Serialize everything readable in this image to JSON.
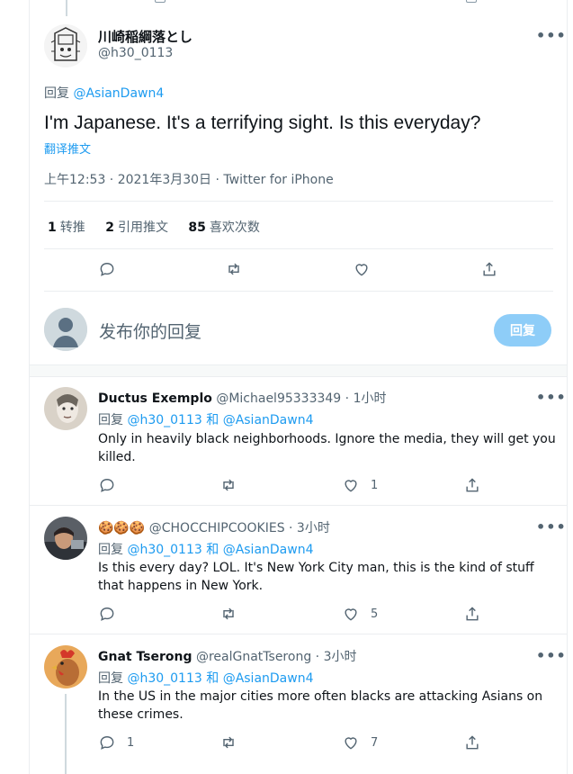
{
  "main_tweet": {
    "author_name": "川崎稲綱落とし",
    "author_handle": "@h30_0113",
    "more_glyph": "•••",
    "reply_prefix": "回复",
    "reply_mention": "@AsianDawn4",
    "text": "I'm Japanese. It's a terrifying sight. Is this everyday?",
    "translate_label": "翻译推文",
    "meta": "上午12:53 · 2021年3月30日 · Twitter for iPhone",
    "stats": {
      "retweets_count": "1",
      "retweets_label": "转推",
      "quotes_count": "2",
      "quotes_label": "引用推文",
      "likes_count": "85",
      "likes_label": "喜欢次数"
    },
    "actions": [
      "reply-icon",
      "retweet-icon",
      "like-icon",
      "share-icon"
    ]
  },
  "compose": {
    "placeholder": "发布你的回复",
    "button_label": "回复"
  },
  "replies": [
    {
      "name": "Ductus Exemplo",
      "handle": "@Michael95333349",
      "time": "· 1小时",
      "reply_prefix": "回复",
      "mention1": "@h30_0113",
      "and_label": "和",
      "mention2": "@AsianDawn4",
      "text": "Only in heavily black neighborhoods. Ignore the media, they will get you killed.",
      "reply_count": "",
      "retweet_count": "",
      "like_count": "1"
    },
    {
      "name": "🍪🍪🍪",
      "handle": "@CHOCCHIPCOOKIES",
      "time": "· 3小时",
      "reply_prefix": "回复",
      "mention1": "@h30_0113",
      "and_label": "和",
      "mention2": "@AsianDawn4",
      "text": "Is this every day? LOL. It's New York City man, this is the kind of stuff that happens in New York.",
      "reply_count": "",
      "retweet_count": "",
      "like_count": "5"
    },
    {
      "name": "Gnat Tserong",
      "handle": "@realGnatTserong",
      "time": "· 3小时",
      "reply_prefix": "回复",
      "mention1": "@h30_0113",
      "and_label": "和",
      "mention2": "@AsianDawn4",
      "text": "In the US in the major cities more often blacks are attacking Asians on these crimes.",
      "reply_count": "1",
      "retweet_count": "",
      "like_count": "7"
    }
  ],
  "colors": {
    "accent": "#1d9bf0",
    "muted": "#536471",
    "reply_button": "#8ecdf8"
  }
}
